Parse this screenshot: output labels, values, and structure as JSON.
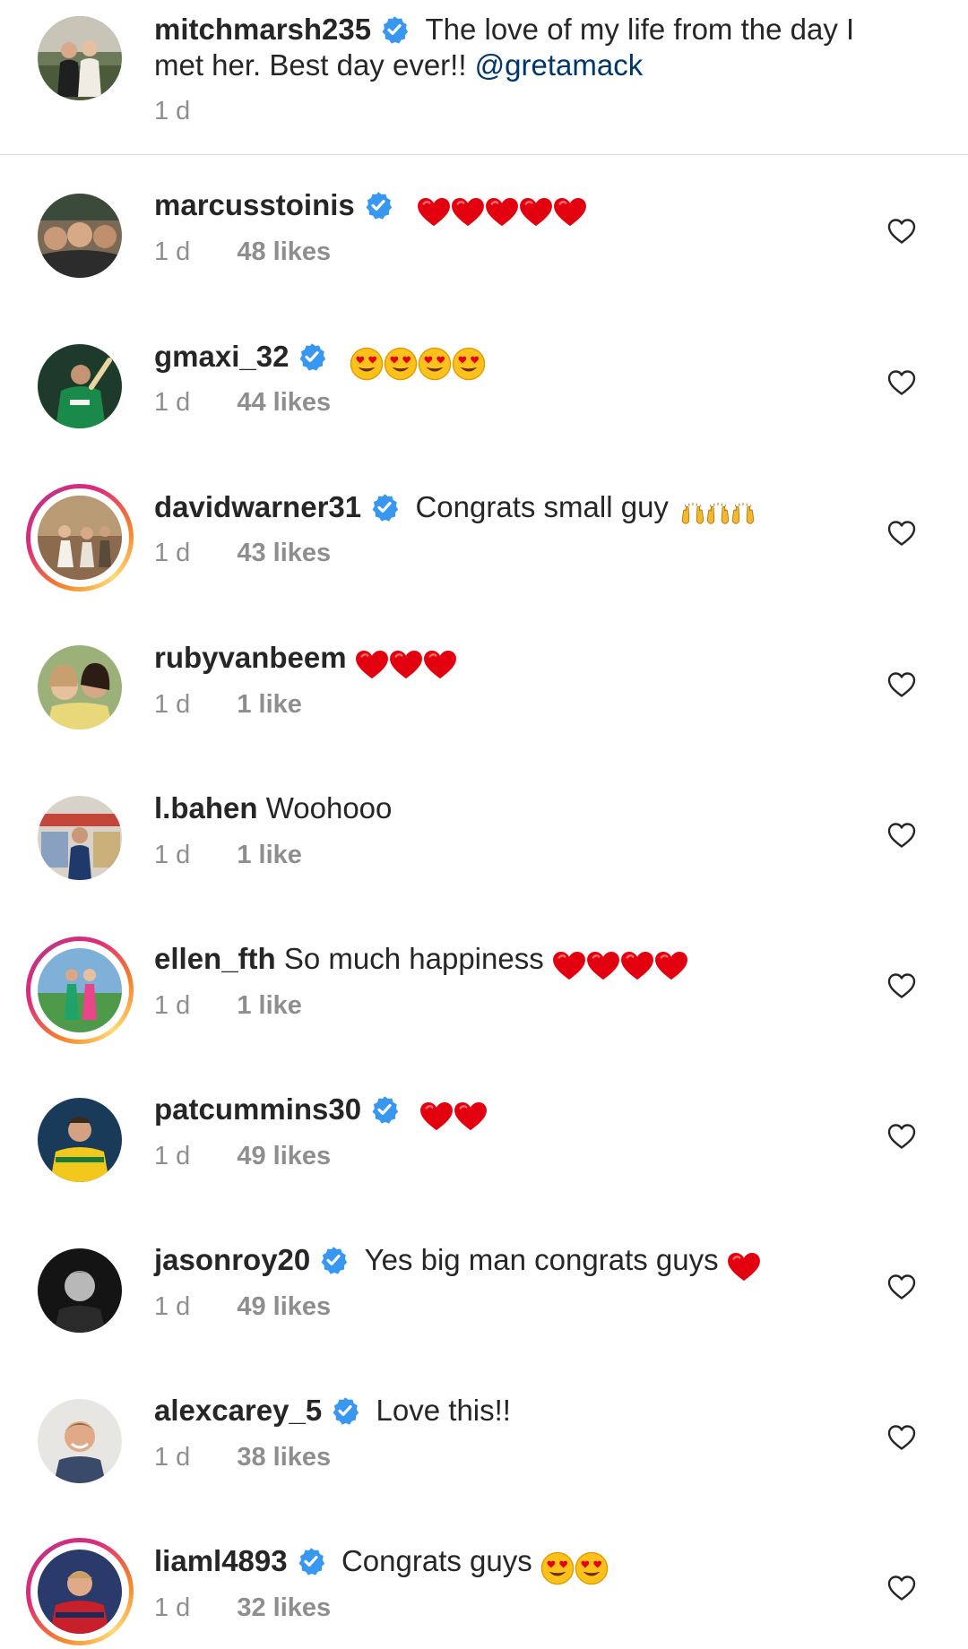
{
  "caption": {
    "username": "mitchmarsh235",
    "text_line1": "The love of my life from the day I",
    "text_line2": "met her. Best day ever!! ",
    "mention": "@gretamack",
    "time": "1 d"
  },
  "comments": [
    {
      "username": "marcusstoinis",
      "verified": true,
      "text": "",
      "emoji": "red-heart x5",
      "time": "1 d",
      "likes": "48 likes"
    },
    {
      "username": "gmaxi_32",
      "verified": true,
      "text": "",
      "emoji": "heart-eyes x4",
      "time": "1 d",
      "likes": "44 likes"
    },
    {
      "username": "davidwarner31",
      "verified": true,
      "text": "Congrats small guy",
      "emoji": "raising-hands x3",
      "time": "1 d",
      "likes": "43 likes"
    },
    {
      "username": "rubyvanbeem",
      "verified": false,
      "text": "",
      "emoji": "red-heart x3",
      "time": "1 d",
      "likes": "1 like"
    },
    {
      "username": "l.bahen",
      "verified": false,
      "text": "Woohooo",
      "emoji": "",
      "time": "1 d",
      "likes": "1 like"
    },
    {
      "username": "ellen_fth",
      "verified": false,
      "text": "So much happiness",
      "emoji": "red-heart x4",
      "time": "1 d",
      "likes": "1 like"
    },
    {
      "username": "patcummins30",
      "verified": true,
      "text": "",
      "emoji": "red-heart x2",
      "time": "1 d",
      "likes": "49 likes"
    },
    {
      "username": "jasonroy20",
      "verified": true,
      "text": "Yes big man congrats guys",
      "emoji": "red-heart x1",
      "time": "1 d",
      "likes": "49 likes"
    },
    {
      "username": "alexcarey_5",
      "verified": true,
      "text": "Love this!!",
      "emoji": "",
      "time": "1 d",
      "likes": "38 likes"
    },
    {
      "username": "liaml4893",
      "verified": true,
      "text": "Congrats guys",
      "emoji": "heart-eyes x2",
      "time": "1 d",
      "likes": "32 likes"
    }
  ],
  "colors": {
    "verified_blue": "#3897f0",
    "mention_blue": "#00376b",
    "meta_gray": "#8e8e8e",
    "heart_red": "#ed1c24"
  },
  "icons": [
    "verified-badge-icon",
    "like-heart-icon",
    "red-heart-emoji",
    "heart-eyes-emoji",
    "raising-hands-emoji"
  ]
}
